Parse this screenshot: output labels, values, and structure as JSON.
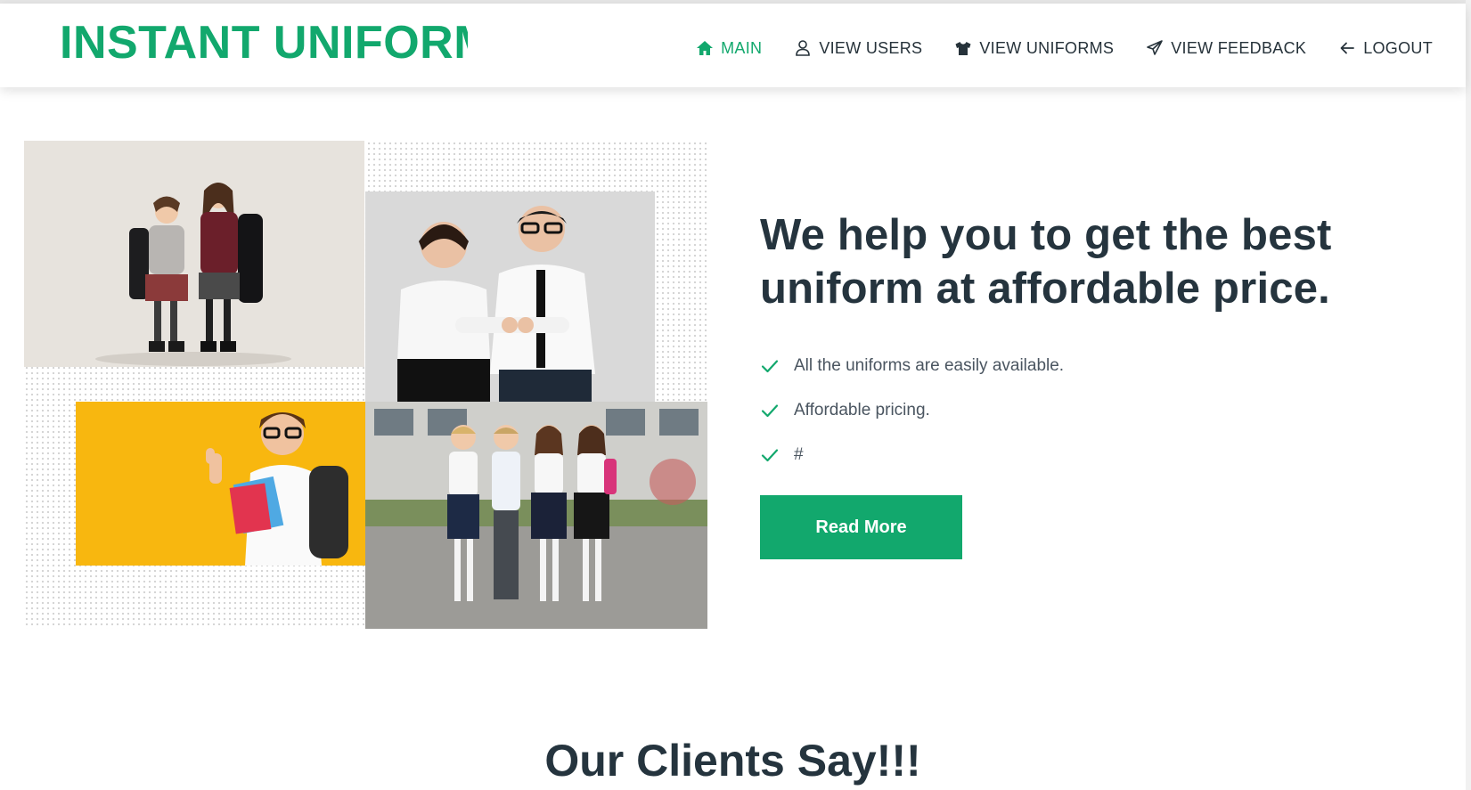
{
  "brand": {
    "name": "INSTANT UNIFORM",
    "color": "#12a86d"
  },
  "nav": {
    "items": [
      {
        "label": "MAIN",
        "icon": "home-icon",
        "active": true
      },
      {
        "label": "VIEW USERS",
        "icon": "user-icon",
        "active": false
      },
      {
        "label": "VIEW UNIFORMS",
        "icon": "tshirt-icon",
        "active": false
      },
      {
        "label": "VIEW FEEDBACK",
        "icon": "paper-plane-icon",
        "active": false
      },
      {
        "label": "LOGOUT",
        "icon": "arrow-left-icon",
        "active": false
      }
    ]
  },
  "hero": {
    "title": "We help you to get the best uniform at affordable price.",
    "features": [
      "All the uniforms are easily available.",
      "Affordable pricing.",
      "#"
    ],
    "cta_label": "Read More"
  },
  "clients": {
    "title": "Our Clients Say!!!"
  },
  "colors": {
    "accent": "#12a86d",
    "heading": "#25343e",
    "text": "#4a5560"
  }
}
